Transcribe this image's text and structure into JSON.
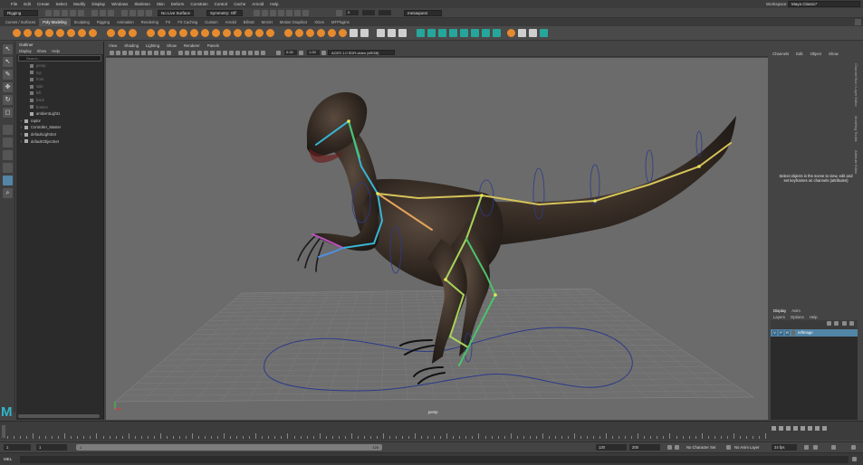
{
  "menubar": {
    "items": [
      "File",
      "Edit",
      "Create",
      "Select",
      "Modify",
      "Display",
      "Windows",
      "Skeleton",
      "Skin",
      "Deform",
      "Constrain",
      "Control",
      "Cache",
      "Arnold",
      "Help"
    ],
    "workspace_label": "Workspace:",
    "workspace_value": "Maya Classic*"
  },
  "status": {
    "menuset": "Rigging",
    "live_surface": "No Live Surface",
    "symmetry": "Symmetry: Off",
    "field_value": "0",
    "object_name": "mesaquest"
  },
  "shelf": {
    "tabs": [
      "Curves / Surfaces",
      "Poly Modeling",
      "Sculpting",
      "Rigging",
      "Animation",
      "Rendering",
      "FX",
      "FX Caching",
      "Custom",
      "Arnold",
      "Bifrost",
      "MASH",
      "Motion Graphics",
      "XGen",
      "MTPlugins"
    ],
    "active_tab": "Poly Modeling"
  },
  "outliner": {
    "title": "Outliner",
    "menu": [
      "Display",
      "Show",
      "Help"
    ],
    "search_placeholder": "Search...",
    "items": [
      {
        "label": "persp",
        "dim": true,
        "indent": 1
      },
      {
        "label": "top",
        "dim": true,
        "indent": 1
      },
      {
        "label": "front",
        "dim": true,
        "indent": 1
      },
      {
        "label": "side",
        "dim": true,
        "indent": 1
      },
      {
        "label": "left",
        "dim": true,
        "indent": 1
      },
      {
        "label": "back",
        "dim": true,
        "indent": 1
      },
      {
        "label": "bottom",
        "dim": true,
        "indent": 1
      },
      {
        "label": "ambientLight1",
        "dim": false,
        "indent": 1
      },
      {
        "label": "raptor",
        "dim": false,
        "indent": 0
      },
      {
        "label": "Controller_Master",
        "dim": false,
        "indent": 0
      },
      {
        "label": "defaultLightSet",
        "dim": false,
        "indent": 0
      },
      {
        "label": "defaultObjectSet",
        "dim": false,
        "indent": 0
      }
    ]
  },
  "viewport": {
    "menu": [
      "View",
      "Shading",
      "Lighting",
      "Show",
      "Renderer",
      "Panels"
    ],
    "field_a": "0.00",
    "field_b": "1.00",
    "color_space": "ACES 1.0 SDR-video (sRGB)",
    "camera_label": "persp"
  },
  "channelbox": {
    "menu": [
      "Channels",
      "Edit",
      "Object",
      "Show"
    ],
    "message": "Select objects in the scene to view, edit and set keyframes on channels (attributes)",
    "side_tabs": [
      "Channel Box / Layer Editor",
      "Modeling Toolkit",
      "Attribute Editor"
    ]
  },
  "layers": {
    "tabs": [
      "Display",
      "Anim"
    ],
    "active_tab": "Display",
    "menu": [
      "Layers",
      "Options",
      "Help"
    ],
    "rows": [
      {
        "v": "V",
        "p": "P",
        "r": "R",
        "name": "refImage"
      }
    ]
  },
  "timeline": {
    "start_field": "1",
    "current_field": "1",
    "range_start": "1",
    "range_end": "120",
    "end_field": "120",
    "max_field": "200",
    "character_set": "No Character Set",
    "anim_layer": "No Anim Layer",
    "fps": "24 fps"
  },
  "cmdline": {
    "label": "MEL"
  },
  "colors": {
    "accent": "#5285a6",
    "maya_teal": "#31b5c9",
    "shelf_orange": "#e68a2e",
    "viewport_bg": "#6b6b6b"
  }
}
